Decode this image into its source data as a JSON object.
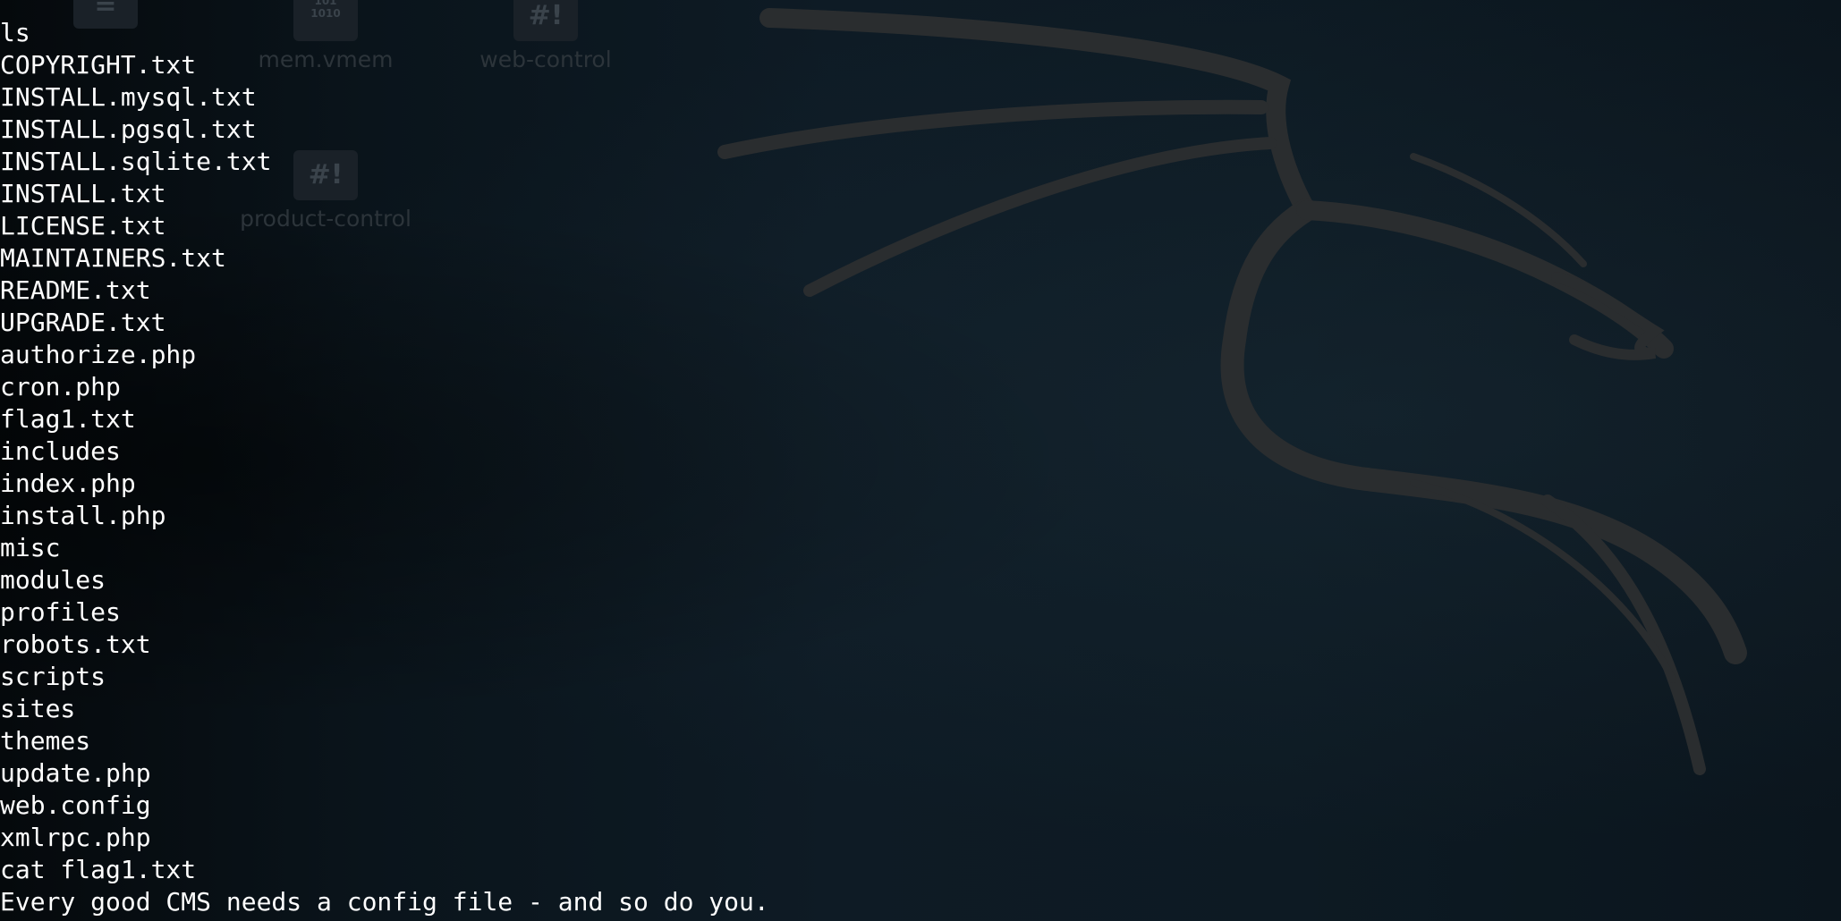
{
  "desktop": {
    "icons": [
      {
        "label": "",
        "icon": "text-file-icon",
        "glyph": ""
      },
      {
        "label": "mem.vmem",
        "icon": "binary-file-icon",
        "glyph": "101\n1010"
      },
      {
        "label": "web-control",
        "icon": "script-file-icon",
        "glyph": "#!"
      },
      {
        "label": "product-control",
        "icon": "script-file-icon",
        "glyph": "#!"
      }
    ]
  },
  "terminal": {
    "lines": [
      "ls",
      "COPYRIGHT.txt",
      "INSTALL.mysql.txt",
      "INSTALL.pgsql.txt",
      "INSTALL.sqlite.txt",
      "INSTALL.txt",
      "LICENSE.txt",
      "MAINTAINERS.txt",
      "README.txt",
      "UPGRADE.txt",
      "authorize.php",
      "cron.php",
      "flag1.txt",
      "includes",
      "index.php",
      "install.php",
      "misc",
      "modules",
      "profiles",
      "robots.txt",
      "scripts",
      "sites",
      "themes",
      "update.php",
      "web.config",
      "xmlrpc.php",
      "cat flag1.txt",
      "Every good CMS needs a config file - and so do you."
    ]
  },
  "colors": {
    "terminal_text": "#ffffff",
    "dragon": "#2a2d2f",
    "background": "#0d1a23"
  }
}
